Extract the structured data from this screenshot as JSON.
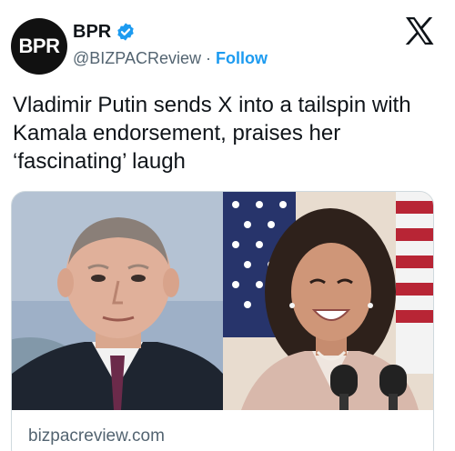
{
  "account": {
    "avatar_text": "BPR",
    "display_name": "BPR",
    "handle": "@BIZPACReview",
    "separator": "·",
    "follow_label": "Follow"
  },
  "icons": {
    "verified": "verified-badge-icon",
    "platform": "x-logo-icon"
  },
  "tweet": {
    "text": "Vladimir Putin sends X into a tailspin with Kamala endorsement, praises her ‘fascinating’ laugh"
  },
  "card": {
    "domain": "bizpacreview.com"
  },
  "colors": {
    "accent": "#1d9bf0",
    "text_primary": "#0f1419",
    "text_secondary": "#536471",
    "avatar_bg": "#111111"
  }
}
